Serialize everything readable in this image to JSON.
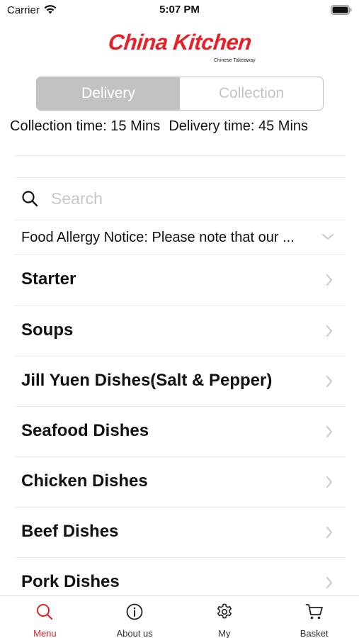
{
  "status_bar": {
    "carrier": "Carrier",
    "time": "5:07 PM"
  },
  "logo": {
    "title": "China Kitchen",
    "subtitle": "Chinese Takeaway",
    "brand_color": "#e8202a"
  },
  "order_mode": {
    "options": [
      "Delivery",
      "Collection"
    ],
    "selected": "Delivery"
  },
  "times": {
    "collection": "Collection time: 15 Mins",
    "delivery": "Delivery time: 45 Mins"
  },
  "search": {
    "placeholder": "Search",
    "value": "",
    "icon": "search-icon"
  },
  "allergy_notice": {
    "text": "Food Allergy Notice: Please note that our ..."
  },
  "categories": [
    {
      "label": "Starter"
    },
    {
      "label": "Soups"
    },
    {
      "label": "Jill Yuen Dishes(Salt & Pepper)"
    },
    {
      "label": "Seafood Dishes"
    },
    {
      "label": "Chicken Dishes"
    },
    {
      "label": "Beef Dishes"
    },
    {
      "label": "Pork Dishes"
    }
  ],
  "tab_bar": {
    "tabs": [
      {
        "label": "Menu",
        "icon": "search-icon",
        "active": true
      },
      {
        "label": "About us",
        "icon": "info-icon",
        "active": false
      },
      {
        "label": "My",
        "icon": "gear-icon",
        "active": false
      },
      {
        "label": "Basket",
        "icon": "cart-icon",
        "active": false
      }
    ],
    "active_color": "#e8202a"
  }
}
